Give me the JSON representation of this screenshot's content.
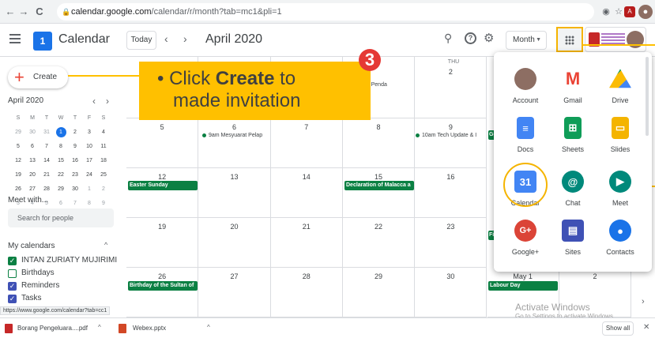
{
  "browser": {
    "url_main": "calendar.google.com",
    "url_rest": "/calendar/r/month?tab=mc1&pli=1",
    "back": "←",
    "forward": "→",
    "reload": "C"
  },
  "header": {
    "app_name": "Calendar",
    "logo_num": "1",
    "today": "Today",
    "month_title": "April 2020",
    "view": "Month"
  },
  "sidebar": {
    "create": "Create",
    "mini_title": "April 2020",
    "weekdays": [
      "S",
      "M",
      "T",
      "W",
      "T",
      "F",
      "S"
    ],
    "mini_days": [
      [
        "29",
        "30",
        "31",
        "1",
        "2",
        "3",
        "4"
      ],
      [
        "5",
        "6",
        "7",
        "8",
        "9",
        "10",
        "11"
      ],
      [
        "12",
        "13",
        "14",
        "15",
        "16",
        "17",
        "18"
      ],
      [
        "19",
        "20",
        "21",
        "22",
        "23",
        "24",
        "25"
      ],
      [
        "26",
        "27",
        "28",
        "29",
        "30",
        "1",
        "2"
      ],
      [
        "3",
        "4",
        "5",
        "6",
        "7",
        "8",
        "9"
      ]
    ],
    "meet_title": "Meet with...",
    "search_placeholder": "Search for people",
    "my_calendars": "My calendars",
    "calendars": [
      {
        "label": "INTAN ZURIATY MUJIRIMI",
        "color": "#0b8043",
        "checked": true
      },
      {
        "label": "Birthdays",
        "color": "#0b8043",
        "checked": false
      },
      {
        "label": "Reminders",
        "color": "#3f51b5",
        "checked": true
      },
      {
        "label": "Tasks",
        "color": "#3f51b5",
        "checked": true
      }
    ],
    "status_url": "https://www.google.com/calendar?tab=cc1"
  },
  "grid": {
    "thu": "THU",
    "cells": [
      {
        "day": "",
        "r": 0,
        "c": 0
      },
      {
        "day": "",
        "r": 0,
        "c": 1
      },
      {
        "day": "",
        "r": 0,
        "c": 2
      },
      {
        "day": "",
        "r": 0,
        "c": 3
      },
      {
        "day": "2",
        "r": 0,
        "c": 4
      },
      {
        "day": "5",
        "r": 1,
        "c": 0
      },
      {
        "day": "6",
        "r": 1,
        "c": 1
      },
      {
        "day": "7",
        "r": 1,
        "c": 2
      },
      {
        "day": "8",
        "r": 1,
        "c": 3
      },
      {
        "day": "9",
        "r": 1,
        "c": 4
      },
      {
        "day": "12",
        "r": 2,
        "c": 0
      },
      {
        "day": "13",
        "r": 2,
        "c": 1
      },
      {
        "day": "14",
        "r": 2,
        "c": 2
      },
      {
        "day": "15",
        "r": 2,
        "c": 3
      },
      {
        "day": "16",
        "r": 2,
        "c": 4
      },
      {
        "day": "19",
        "r": 3,
        "c": 0
      },
      {
        "day": "20",
        "r": 3,
        "c": 1
      },
      {
        "day": "21",
        "r": 3,
        "c": 2
      },
      {
        "day": "22",
        "r": 3,
        "c": 3
      },
      {
        "day": "23",
        "r": 3,
        "c": 4
      },
      {
        "day": "26",
        "r": 4,
        "c": 0
      },
      {
        "day": "27",
        "r": 4,
        "c": 1
      },
      {
        "day": "28",
        "r": 4,
        "c": 2
      },
      {
        "day": "29",
        "r": 4,
        "c": 3
      },
      {
        "day": "30",
        "r": 4,
        "c": 4
      },
      {
        "day": "May 1",
        "r": 4,
        "c": 5
      },
      {
        "day": "2",
        "r": 4,
        "c": 6
      }
    ],
    "events": {
      "taklimat": "Taklimat Penda",
      "mesyuarat": "9am Mesyuarat Pelap",
      "tech": "10am Tech Update & I",
      "easter": "Easter Sunday",
      "malacca": "Declaration of Malacca a",
      "sultan": "Birthday of the Sultan of",
      "labour": "Labour Day",
      "go": "Go",
      "fi": "Fi"
    }
  },
  "callout": {
    "prefix": "Click ",
    "bold": "Create",
    "suffix": " to",
    "line2": "made invitation",
    "step": "3"
  },
  "apps": [
    {
      "label": "Account",
      "icon": "account-icon"
    },
    {
      "label": "Gmail",
      "icon": "gmail-icon"
    },
    {
      "label": "Drive",
      "icon": "drive-icon"
    },
    {
      "label": "Docs",
      "icon": "docs-icon"
    },
    {
      "label": "Sheets",
      "icon": "sheets-icon"
    },
    {
      "label": "Slides",
      "icon": "slides-icon"
    },
    {
      "label": "Calendar",
      "icon": "calendar-icon"
    },
    {
      "label": "Chat",
      "icon": "chat-icon"
    },
    {
      "label": "Meet",
      "icon": "meet-icon"
    },
    {
      "label": "Google+",
      "icon": "google-plus-icon"
    },
    {
      "label": "Sites",
      "icon": "sites-icon"
    },
    {
      "label": "Contacts",
      "icon": "contacts-icon"
    }
  ],
  "apps_calendar_num": "31",
  "watermark": {
    "line1": "Activate Windows",
    "line2": "Go to Settings to activate Windows."
  },
  "downloads": {
    "file1": "Borang Pengeluara....pdf",
    "file2": "Webex.pptx",
    "show_all": "Show all"
  }
}
